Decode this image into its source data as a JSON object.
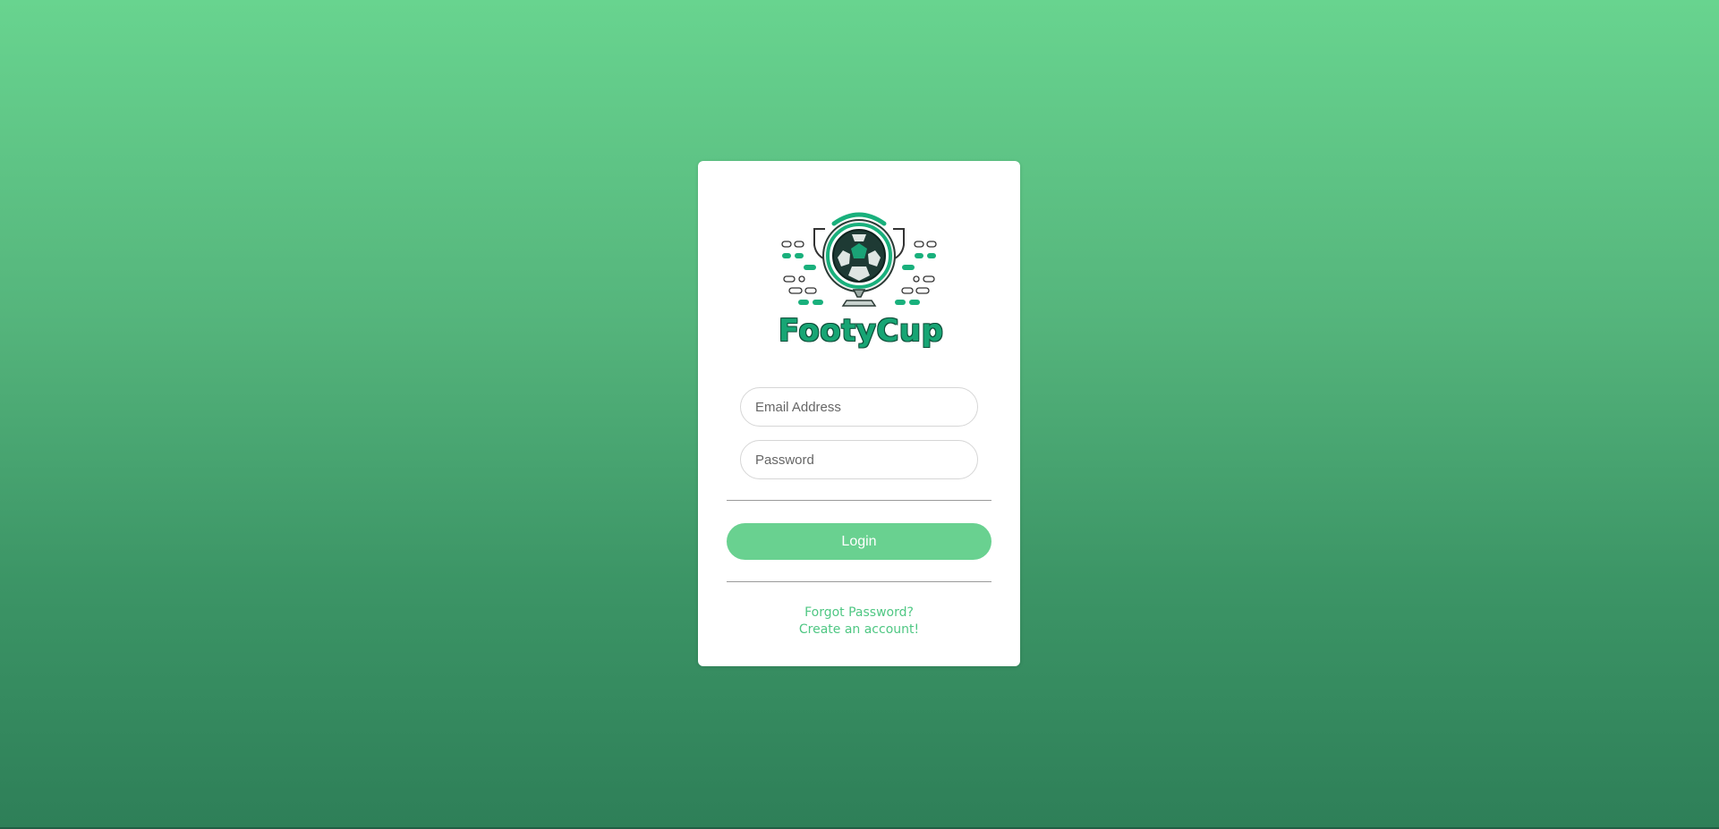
{
  "brand": {
    "name": "FootyCup",
    "logo_icon": "trophy-soccer-ball-icon"
  },
  "form": {
    "email_placeholder": "Email Address",
    "password_placeholder": "Password",
    "login_label": "Login"
  },
  "links": {
    "forgot_password": "Forgot Password?",
    "create_account": "Create an account!"
  },
  "colors": {
    "background_top": "#68d48f",
    "background_bottom": "#2e7f58",
    "accent": "#69d190",
    "link": "#4fc783",
    "brand_text": "#17a574"
  }
}
